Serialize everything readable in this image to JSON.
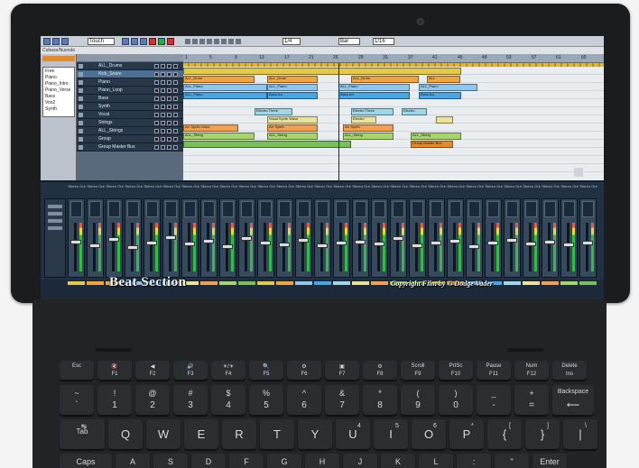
{
  "daw": {
    "toolbar": {
      "tempo_field": "Touch",
      "zoom_field": "1/4",
      "bar_field": "Bar",
      "snap_field": "1/16"
    },
    "status_text": "Cubase/Nuendo",
    "inspector": {
      "items": [
        "Free",
        "Piano",
        "Piano_Intro",
        "Piano_Verse",
        "Bass",
        "Vox2",
        "Synth"
      ]
    },
    "tracks": [
      {
        "name": "ALL_Drums",
        "selected": false
      },
      {
        "name": "Kick_Snare",
        "selected": true
      },
      {
        "name": "Piano",
        "selected": false
      },
      {
        "name": "Piano_Loop",
        "selected": false
      },
      {
        "name": "Bass",
        "selected": false
      },
      {
        "name": "Synth",
        "selected": false
      },
      {
        "name": "Vocal",
        "selected": false
      },
      {
        "name": "Strings",
        "selected": false
      },
      {
        "name": "ALL_Strings",
        "selected": false
      },
      {
        "name": "Group",
        "selected": false
      },
      {
        "name": "Group Master Bus",
        "selected": false
      }
    ],
    "ruler": [
      "1",
      "5",
      "9",
      "13",
      "17",
      "21",
      "25",
      "29",
      "33",
      "37",
      "41",
      "45",
      "49",
      "53",
      "57",
      "61",
      "65"
    ],
    "clips": [
      {
        "lane": 0,
        "from": 0.0,
        "to": 0.66,
        "color": "#e3c84a",
        "label": ""
      },
      {
        "lane": 1,
        "from": 0.0,
        "to": 0.17,
        "color": "#f0a542",
        "label": "ALL_Drum"
      },
      {
        "lane": 1,
        "from": 0.2,
        "to": 0.32,
        "color": "#f0a542",
        "label": "ALL_Drum"
      },
      {
        "lane": 1,
        "from": 0.4,
        "to": 0.56,
        "color": "#f0a542",
        "label": "ALL_Drum"
      },
      {
        "lane": 1,
        "from": 0.58,
        "to": 0.66,
        "color": "#f0a542",
        "label": "ALL"
      },
      {
        "lane": 2,
        "from": 0.0,
        "to": 0.2,
        "color": "#8ec6ee",
        "label": "ALL_Piano"
      },
      {
        "lane": 2,
        "from": 0.2,
        "to": 0.32,
        "color": "#8ec6ee",
        "label": "ALL_Piano"
      },
      {
        "lane": 2,
        "from": 0.37,
        "to": 0.54,
        "color": "#8ec6ee",
        "label": "ALL_Piano"
      },
      {
        "lane": 2,
        "from": 0.56,
        "to": 0.7,
        "color": "#8ec6ee",
        "label": "ALL_Piano"
      },
      {
        "lane": 3,
        "from": 0.0,
        "to": 0.2,
        "color": "#4aa6e0",
        "label": "ALL_Piano"
      },
      {
        "lane": 3,
        "from": 0.2,
        "to": 0.32,
        "color": "#4aa6e0",
        "label": "Bass Arr"
      },
      {
        "lane": 3,
        "from": 0.37,
        "to": 0.54,
        "color": "#4aa6e0",
        "label": "Bass Arr"
      },
      {
        "lane": 3,
        "from": 0.56,
        "to": 0.66,
        "color": "#4aa6e0",
        "label": "Bass Arr"
      },
      {
        "lane": 5,
        "from": 0.17,
        "to": 0.26,
        "color": "#9fd6e8",
        "label": "Electro Three"
      },
      {
        "lane": 5,
        "from": 0.4,
        "to": 0.5,
        "color": "#9fd6e8",
        "label": "Electro Three"
      },
      {
        "lane": 5,
        "from": 0.52,
        "to": 0.58,
        "color": "#9fd6e8",
        "label": "Electro"
      },
      {
        "lane": 6,
        "from": 0.2,
        "to": 0.32,
        "color": "#e9e49a",
        "label": "Vocal Synth Wave"
      },
      {
        "lane": 6,
        "from": 0.4,
        "to": 0.46,
        "color": "#e9e49a",
        "label": "Electro"
      },
      {
        "lane": 6,
        "from": 0.6,
        "to": 0.64,
        "color": "#e9e49a",
        "label": ""
      },
      {
        "lane": 7,
        "from": 0.0,
        "to": 0.13,
        "color": "#f2a050",
        "label": "Arr Synth Voice"
      },
      {
        "lane": 7,
        "from": 0.2,
        "to": 0.32,
        "color": "#f2a050",
        "label": "Arr Synth"
      },
      {
        "lane": 7,
        "from": 0.38,
        "to": 0.5,
        "color": "#f2a050",
        "label": "Arr Synth"
      },
      {
        "lane": 8,
        "from": 0.0,
        "to": 0.17,
        "color": "#a8d46e",
        "label": "ALL_String"
      },
      {
        "lane": 8,
        "from": 0.2,
        "to": 0.32,
        "color": "#a8d46e",
        "label": "ALL_String"
      },
      {
        "lane": 8,
        "from": 0.38,
        "to": 0.5,
        "color": "#a8d46e",
        "label": "ALL_String"
      },
      {
        "lane": 8,
        "from": 0.54,
        "to": 0.66,
        "color": "#a8d46e",
        "label": "ALL_String"
      },
      {
        "lane": 9,
        "from": 0.0,
        "to": 0.4,
        "color": "#7bbf5b",
        "label": ""
      },
      {
        "lane": 9,
        "from": 0.54,
        "to": 0.64,
        "color": "#e38b2d",
        "label": "Group Master Bus"
      }
    ],
    "mixer": {
      "channel_names": [
        "Stereo Out",
        "Stereo Out",
        "Stereo Out",
        "Stereo Out",
        "Stereo Out",
        "Stereo Out",
        "Stereo Out",
        "Stereo Out",
        "Stereo Out",
        "Stereo Out",
        "Stereo Out",
        "Stereo Out",
        "Stereo Out",
        "Stereo Out",
        "Stereo Out",
        "Stereo Out",
        "Stereo Out",
        "Stereo Out",
        "Stereo Out",
        "Stereo Out",
        "Stereo Out",
        "Stereo Out",
        "Stereo Out",
        "Stereo Out",
        "Stereo Out",
        "Stereo Out",
        "Stereo Out",
        "Stereo Out"
      ],
      "fader_levels": [
        0.62,
        0.55,
        0.68,
        0.5,
        0.6,
        0.72,
        0.58,
        0.64,
        0.52,
        0.7,
        0.6,
        0.56,
        0.66,
        0.54,
        0.6,
        0.62,
        0.58,
        0.7,
        0.55,
        0.6,
        0.64,
        0.52,
        0.6,
        0.66,
        0.58,
        0.62,
        0.56,
        0.6
      ],
      "channel_colors": [
        "#e3c84a",
        "#f0a542",
        "#f0a542",
        "#8ec6ee",
        "#4aa6e0",
        "#9fd6e8",
        "#e9e49a",
        "#f2a050",
        "#a8d46e",
        "#7bbf5b",
        "#e3c84a",
        "#f0a542",
        "#8ec6ee",
        "#4aa6e0",
        "#9fd6e8",
        "#e9e49a",
        "#f2a050",
        "#a8d46e",
        "#7bbf5b",
        "#e3c84a",
        "#f0a542",
        "#8ec6ee",
        "#4aa6e0",
        "#9fd6e8",
        "#e9e49a",
        "#f2a050",
        "#a8d46e",
        "#7bbf5b"
      ]
    },
    "overlay_title": "Beat Section",
    "overlay_copyright": "Copyright Film by © Dodge Vader"
  },
  "keyboard": {
    "function_row": [
      {
        "top": "Esc",
        "bottom": ""
      },
      {
        "top": "🔇",
        "bottom": "F1"
      },
      {
        "top": "◀",
        "bottom": "F2"
      },
      {
        "top": "🔊",
        "bottom": "F3"
      },
      {
        "top": "☀/☀",
        "bottom": "F4"
      },
      {
        "top": "🔍",
        "bottom": "F5"
      },
      {
        "top": "⚙",
        "bottom": "F6"
      },
      {
        "top": "▣",
        "bottom": "F7"
      },
      {
        "top": "⚙",
        "bottom": "F8"
      },
      {
        "top": "Scroll",
        "bottom": "F9"
      },
      {
        "top": "PrtSc",
        "bottom": "F10"
      },
      {
        "top": "Pause",
        "bottom": "F11"
      },
      {
        "top": "Num",
        "bottom": "F12"
      },
      {
        "top": "Delete",
        "bottom": "Ins"
      }
    ],
    "number_row": [
      {
        "top": "~",
        "bottom": "`"
      },
      {
        "top": "!",
        "bottom": "1"
      },
      {
        "top": "@",
        "bottom": "2"
      },
      {
        "top": "#",
        "bottom": "3"
      },
      {
        "top": "$",
        "bottom": "4"
      },
      {
        "top": "%",
        "bottom": "5"
      },
      {
        "top": "^",
        "bottom": "6"
      },
      {
        "top": "&",
        "bottom": "7"
      },
      {
        "top": "*",
        "bottom": "8"
      },
      {
        "top": "(",
        "bottom": "9"
      },
      {
        "top": ")",
        "bottom": "0"
      },
      {
        "top": "_",
        "bottom": "-"
      },
      {
        "top": "+",
        "bottom": "="
      },
      {
        "top": "Backspace",
        "bottom": "⟵"
      }
    ],
    "qwerty_row": [
      {
        "main": "Tab",
        "alt": "↹"
      },
      {
        "main": "Q",
        "alt": ""
      },
      {
        "main": "W",
        "alt": ""
      },
      {
        "main": "E",
        "alt": ""
      },
      {
        "main": "R",
        "alt": ""
      },
      {
        "main": "T",
        "alt": ""
      },
      {
        "main": "Y",
        "alt": ""
      },
      {
        "main": "U",
        "alt": "4"
      },
      {
        "main": "I",
        "alt": "5"
      },
      {
        "main": "O",
        "alt": "6"
      },
      {
        "main": "P",
        "alt": "*"
      },
      {
        "main": "{",
        "alt": "["
      },
      {
        "main": "}",
        "alt": "]"
      },
      {
        "main": "|",
        "alt": "\\"
      }
    ],
    "home_row": [
      "Caps",
      "A",
      "S",
      "D",
      "F",
      "G",
      "H",
      "J",
      "K",
      "L",
      ":",
      "\"",
      "Enter"
    ],
    "accent": "#222325"
  }
}
